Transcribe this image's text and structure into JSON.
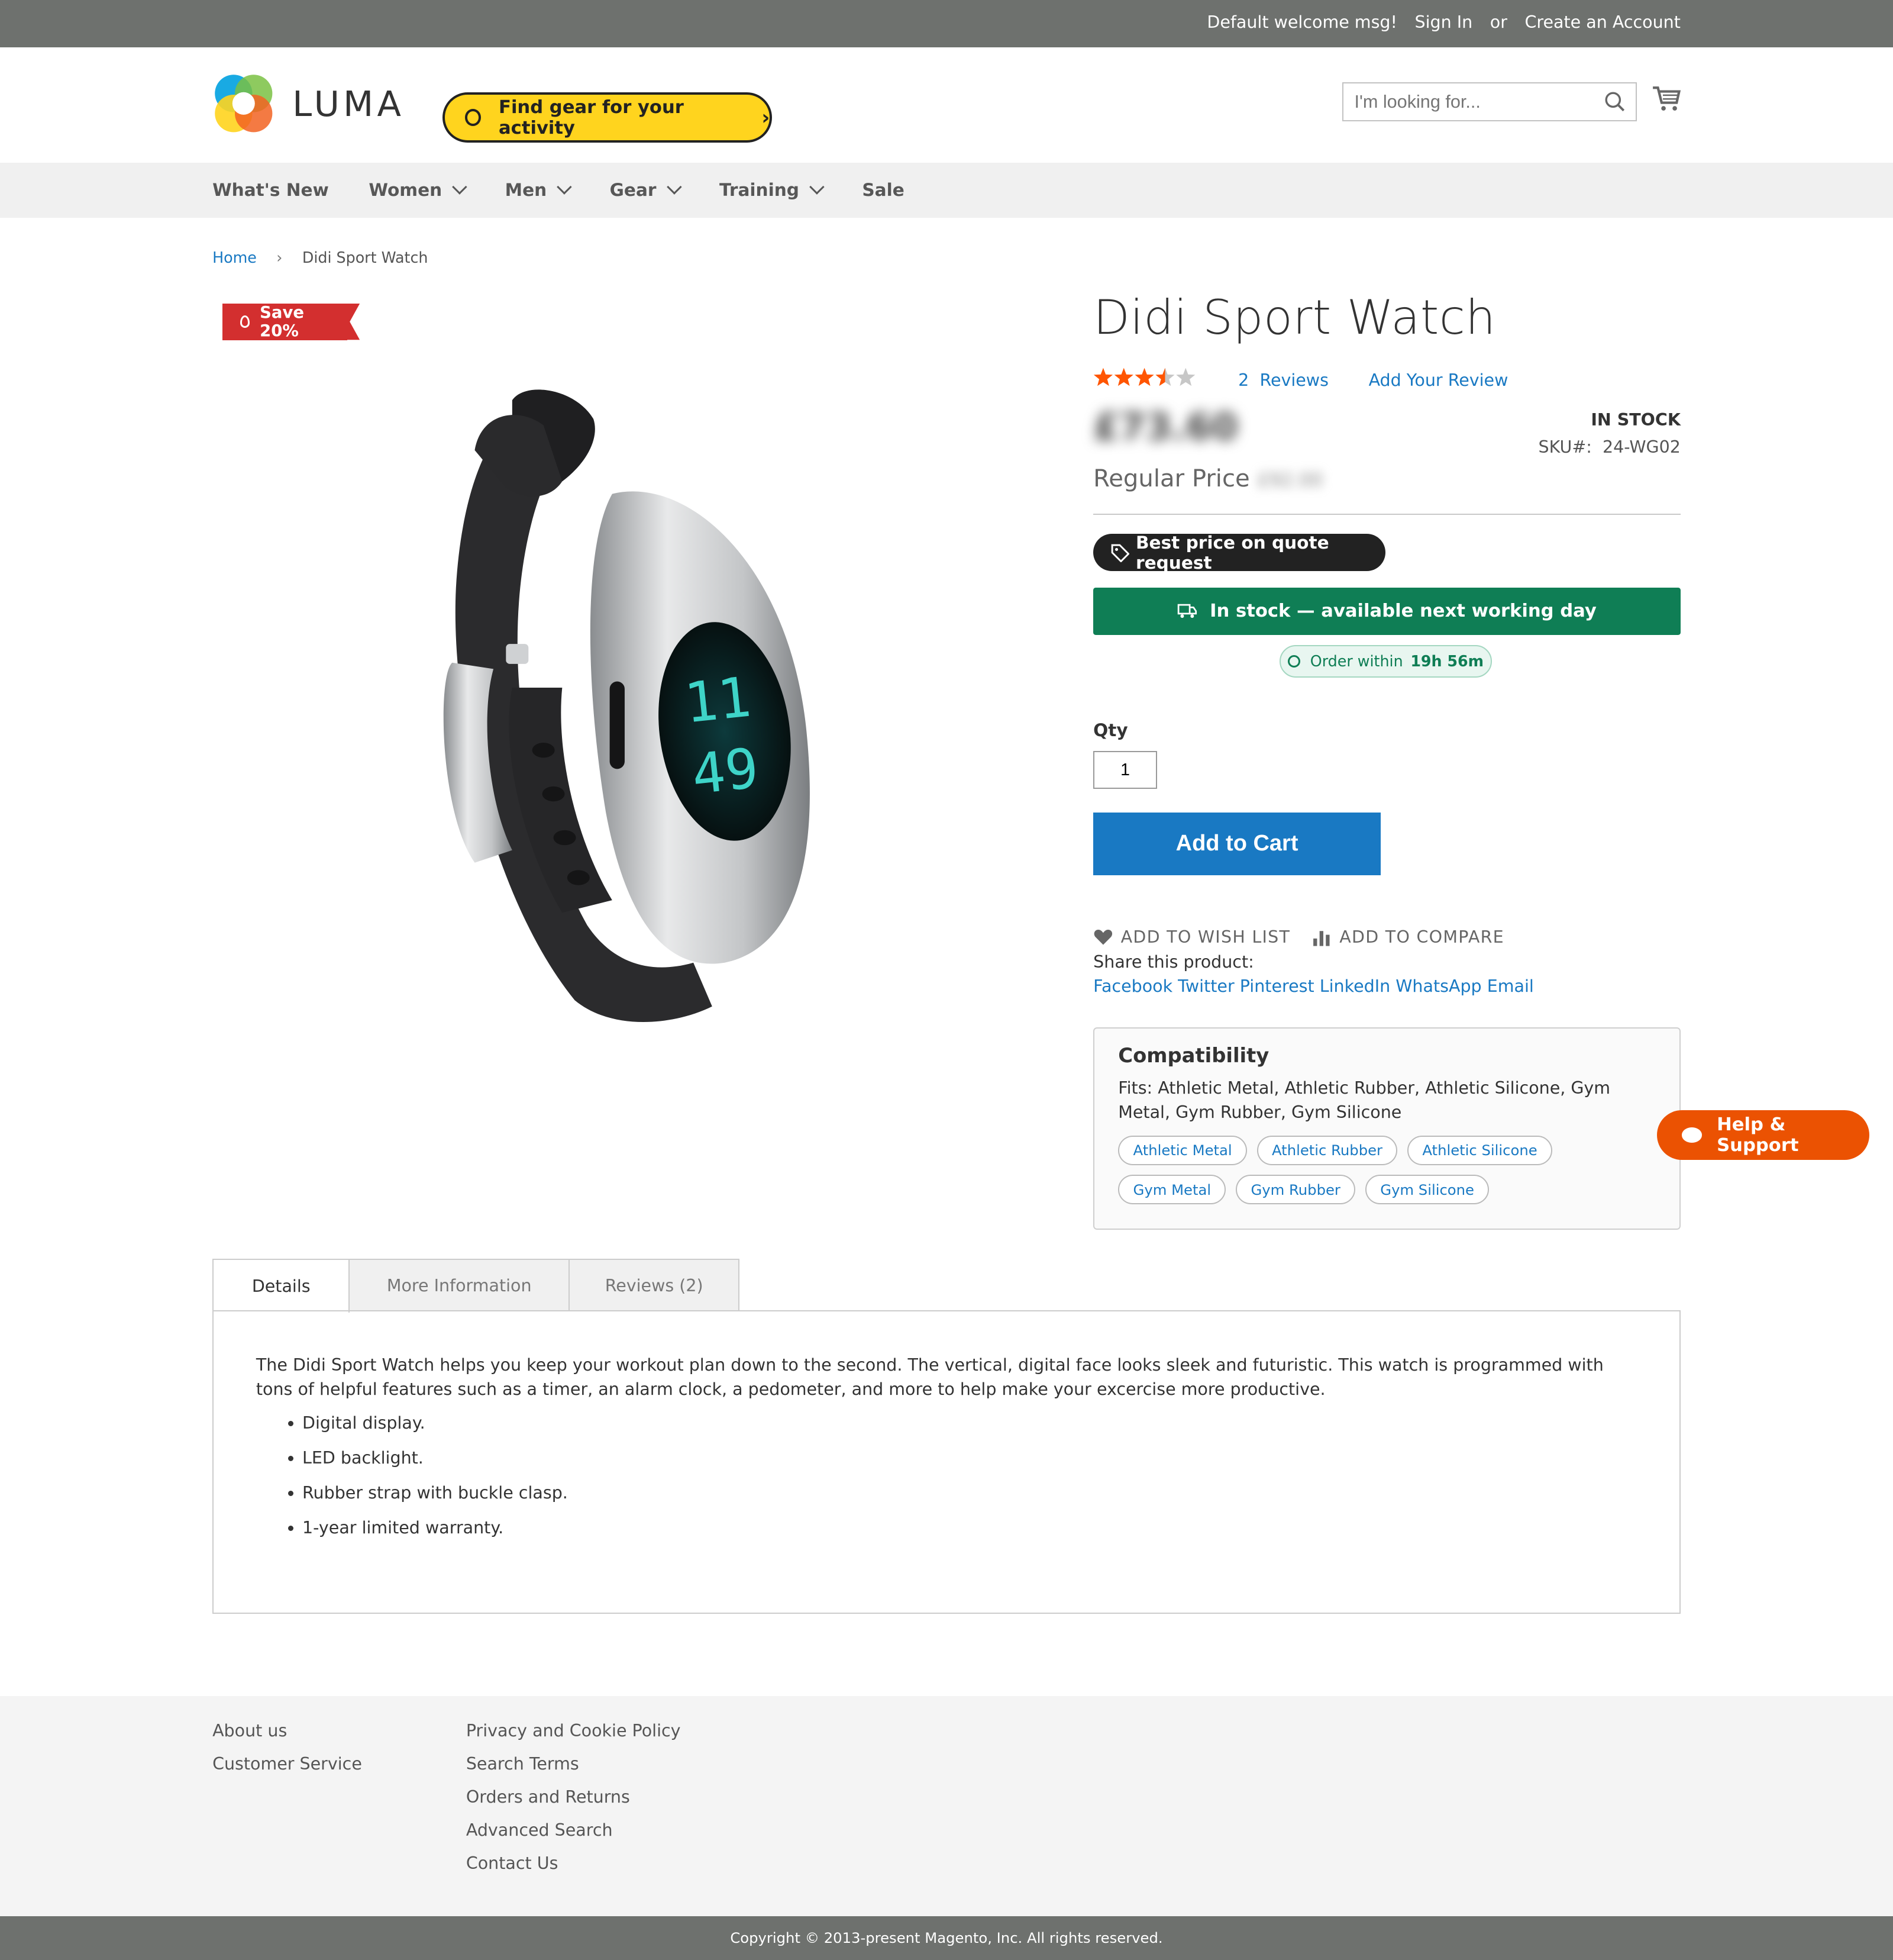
{
  "topbar": {
    "welcome": "Default welcome msg!",
    "sign_in": "Sign In",
    "or": "or",
    "create_account": "Create an Account"
  },
  "header": {
    "logo_text": "LUMA",
    "gear_button": "Find gear for your activity",
    "search_placeholder": "I'm looking for...",
    "cart_icon": "cart-icon"
  },
  "nav": {
    "items": [
      {
        "label": "What's New",
        "dropdown": false
      },
      {
        "label": "Women",
        "dropdown": true
      },
      {
        "label": "Men",
        "dropdown": true
      },
      {
        "label": "Gear",
        "dropdown": true
      },
      {
        "label": "Training",
        "dropdown": true
      },
      {
        "label": "Sale",
        "dropdown": false
      }
    ]
  },
  "breadcrumb": {
    "home": "Home",
    "current": "Didi Sport Watch"
  },
  "badge": {
    "save": "Save 20%"
  },
  "product": {
    "title": "Didi Sport Watch",
    "rating_fraction": 0.7,
    "rating_stars": "3.5 of 5",
    "reviews_count": "2",
    "reviews_label": "Reviews",
    "add_review": "Add Your Review",
    "price": "£73.60",
    "regular_price_label": "Regular Price",
    "regular_price": "£92.00",
    "stock": "IN STOCK",
    "sku_label": "SKU#:",
    "sku": "24-WG02",
    "quote_badge": "Best price on quote request",
    "instock_banner": "In stock — available next working day",
    "order_within_label": "Order within",
    "order_within_time": "19h 56m",
    "qty_label": "Qty",
    "qty_value": "1",
    "add_to_cart": "Add to Cart",
    "wish_list": "ADD TO WISH LIST",
    "compare": "ADD TO COMPARE",
    "share_label": "Share this product:",
    "share_links": [
      "Facebook",
      "Twitter",
      "Pinterest",
      "LinkedIn",
      "WhatsApp",
      "Email"
    ]
  },
  "compatibility": {
    "title": "Compatibility",
    "fits": "Fits: Athletic Metal, Athletic Rubber, Athletic Silicone, Gym Metal, Gym Rubber, Gym Silicone",
    "chips": [
      "Athletic Metal",
      "Athletic Rubber",
      "Athletic Silicone",
      "Gym Metal",
      "Gym Rubber",
      "Gym Silicone"
    ]
  },
  "help": {
    "label": "Help & Support"
  },
  "watch_display": {
    "line1": "11",
    "line2": "49"
  },
  "tabs": [
    {
      "label": "Details",
      "active": true
    },
    {
      "label": "More Information",
      "active": false
    },
    {
      "label": "Reviews (2)",
      "active": false
    }
  ],
  "details": {
    "description": "The Didi Sport Watch helps you keep your workout plan down to the second. The vertical, digital face looks sleek and futuristic. This watch is programmed with tons of helpful features such as a timer, an alarm clock, a pedometer, and more to help make your excercise more productive.",
    "bullets": [
      "Digital display.",
      "LED backlight.",
      "Rubber strap with buckle clasp.",
      "1-year limited warranty."
    ]
  },
  "footer": {
    "col1": [
      "About us",
      "Customer Service"
    ],
    "col2": [
      "Privacy and Cookie Policy",
      "Search Terms",
      "Orders and Returns",
      "Advanced Search",
      "Contact Us"
    ],
    "copyright": "Copyright © 2013-present Magento, Inc. All rights reserved."
  },
  "colors": {
    "accent": "#1979c3",
    "stock_green": "#0f7e55",
    "save_red": "#d32f2f",
    "help_orange": "#eb5202",
    "gear_yellow": "#ffd41e",
    "star_orange": "#ff5501"
  }
}
